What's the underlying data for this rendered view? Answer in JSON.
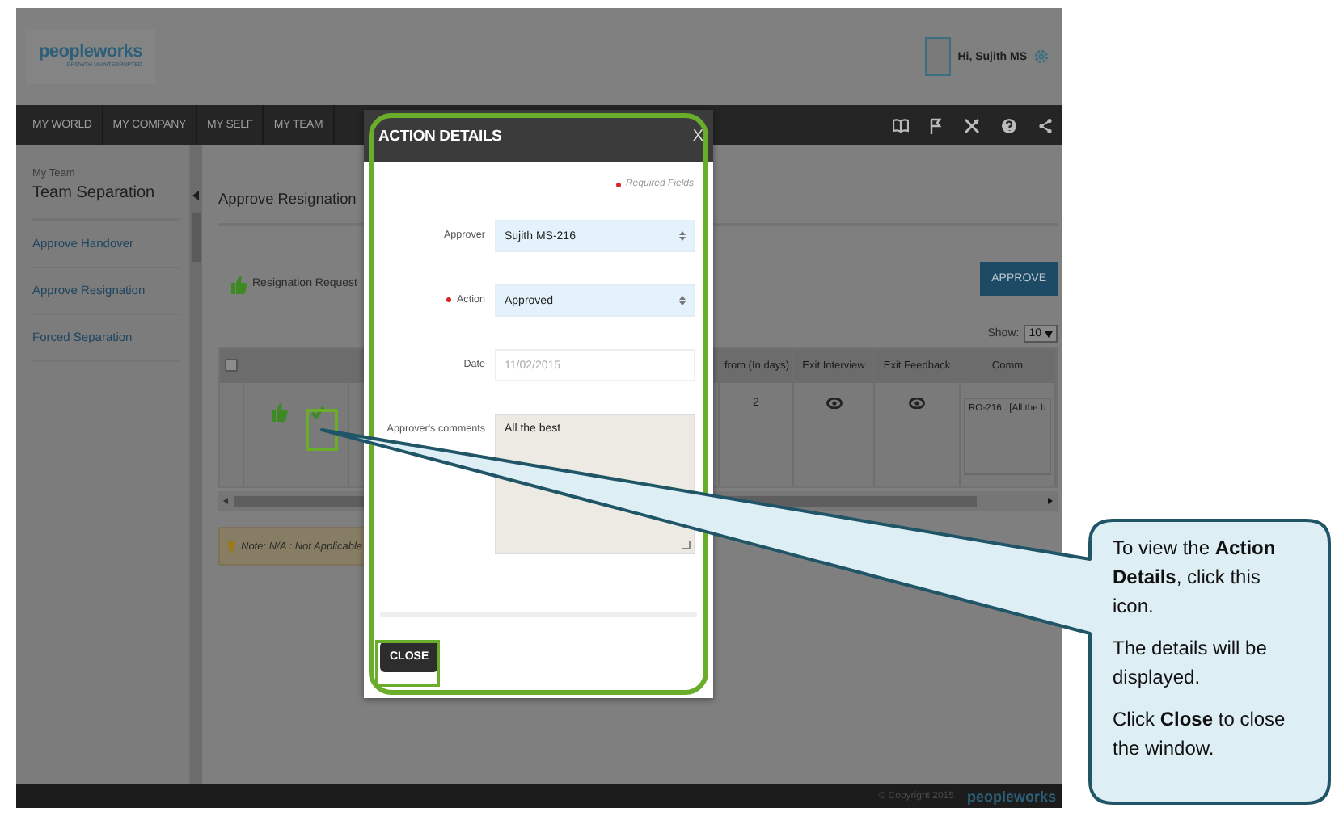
{
  "header": {
    "logo": "peopleworks",
    "tagline": "GROWTH UNINTERRUPTED",
    "greeting": "Hi, Sujith MS"
  },
  "nav": {
    "items": [
      "MY WORLD",
      "MY COMPANY",
      "MY SELF",
      "MY TEAM"
    ]
  },
  "sidebar": {
    "section": "My Team",
    "title": "Team Separation",
    "links": [
      "Approve Handover",
      "Approve Resignation",
      "Forced Separation"
    ]
  },
  "main": {
    "title": "Approve Resignation",
    "legend": "Resignation Request",
    "approve_button": "APPROVE",
    "show_label": "Show:",
    "page_size": "10",
    "table": {
      "select_all_checked": false,
      "columns": [
        "from (In days)",
        "Exit Interview",
        "Exit Feedback",
        "Comm"
      ],
      "rows": [
        {
          "from_days": "2",
          "comment": "RO-216 : [All the b"
        }
      ]
    },
    "note": "Note: N/A : Not Applicable"
  },
  "footer": {
    "copyright": "© Copyright 2015",
    "logo": "peopleworks"
  },
  "dialog": {
    "title": "ACTION DETAILS",
    "close_x": "X",
    "required_note": "Required Fields",
    "fields": [
      {
        "kind": "select",
        "label": "Approver",
        "required": false,
        "disabled": false,
        "value": "Sujith MS-216"
      },
      {
        "kind": "select",
        "label": "Action",
        "required": true,
        "disabled": false,
        "value": "Approved"
      },
      {
        "kind": "date",
        "label": "Date",
        "required": false,
        "disabled": true,
        "value": "11/02/2015"
      },
      {
        "kind": "textarea",
        "label": "Approver's comments",
        "required": false,
        "disabled": false,
        "value": "All the best"
      }
    ],
    "close_button": "CLOSE"
  },
  "callout": {
    "paragraphs": [
      "To view the **Action Details**, click this icon.",
      "The details will be displayed.",
      "Click **Close** to close the window."
    ]
  }
}
